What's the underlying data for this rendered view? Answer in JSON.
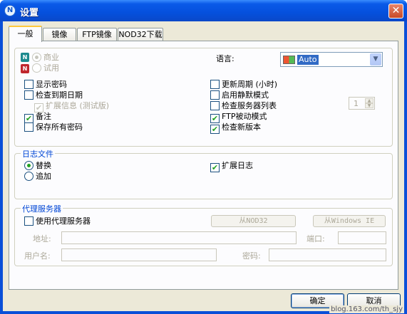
{
  "window": {
    "title": "设置",
    "close_glyph": "✕",
    "icon_glyph": "N"
  },
  "tabs": [
    {
      "label": "一般",
      "active": true
    },
    {
      "label": "镜像"
    },
    {
      "label": "FTP镜像"
    },
    {
      "label": "NOD32下载"
    }
  ],
  "general": {
    "license": {
      "commercial": "商业",
      "trial": "试用"
    },
    "language": {
      "label": "语言:",
      "value": "Auto"
    },
    "update_period": {
      "label": "更新周期 (小时)",
      "value": "1"
    },
    "left_options": [
      {
        "label": "显示密码",
        "checked": false,
        "disabled": false
      },
      {
        "label": "检查到期日期",
        "checked": false,
        "disabled": false
      },
      {
        "label": "扩展信息 (测试版)",
        "checked": true,
        "disabled": true
      },
      {
        "label": "备注",
        "checked": true,
        "disabled": false
      },
      {
        "label": "保存所有密码",
        "checked": false,
        "disabled": false
      }
    ],
    "right_options": [
      {
        "label": "启用静默模式",
        "checked": false
      },
      {
        "label": "检查服务器列表",
        "checked": false
      },
      {
        "label": "FTP被动模式",
        "checked": true
      },
      {
        "label": "检查新版本",
        "checked": true
      }
    ]
  },
  "log": {
    "legend": "日志文件",
    "replace": "替换",
    "append": "追加",
    "extended": "扩展日志"
  },
  "proxy": {
    "legend": "代理服务器",
    "use_proxy": "使用代理服务器",
    "from_nod32": "从NOD32",
    "from_ie": "从Windows IE",
    "address_label": "地址:",
    "port_label": "端口:",
    "username_label": "用户名:",
    "password_label": "密码:"
  },
  "buttons": {
    "ok": "确定",
    "cancel": "取消"
  },
  "watermark": "blog.163.com/th_sjy",
  "check_glyph": "✔",
  "arrow_down": "▼",
  "arrow_up_small": "▲",
  "arrow_down_small": "▼"
}
